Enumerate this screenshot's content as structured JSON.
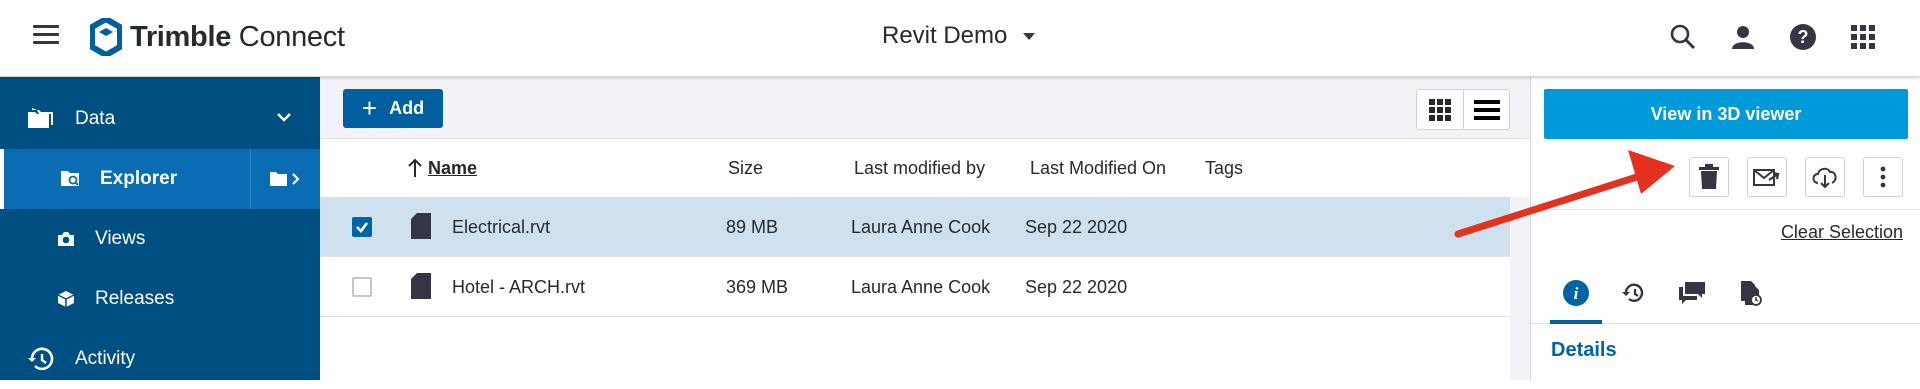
{
  "header": {
    "brand_bold": "Trimble",
    "brand_light": " Connect",
    "project": "Revit Demo"
  },
  "sidebar": {
    "items": [
      {
        "label": "Data"
      },
      {
        "label": "Explorer"
      },
      {
        "label": "Views"
      },
      {
        "label": "Releases"
      },
      {
        "label": "Activity"
      }
    ]
  },
  "toolbar": {
    "add_label": "Add"
  },
  "table": {
    "columns": {
      "name": "Name",
      "size": "Size",
      "modified_by": "Last modified by",
      "modified_on": "Last Modified On",
      "tags": "Tags"
    },
    "rows": [
      {
        "name": "Electrical.rvt",
        "size": "89 MB",
        "modified_by": "Laura Anne Cook",
        "modified_on": "Sep 22 2020",
        "checked": true
      },
      {
        "name": "Hotel - ARCH.rvt",
        "size": "369 MB",
        "modified_by": "Laura Anne Cook",
        "modified_on": "Sep 22 2020",
        "checked": false
      }
    ]
  },
  "panel": {
    "view3d_label": "View in 3D viewer",
    "clear_selection": "Clear Selection",
    "details_title": "Details"
  },
  "colors": {
    "sidebar": "#004f83",
    "sidebar_active": "#0a6cb2",
    "primary": "#005f9e",
    "viewer_button": "#009ad9",
    "selected_row": "#cfe1ee",
    "annotation_arrow": "#e5321e"
  }
}
